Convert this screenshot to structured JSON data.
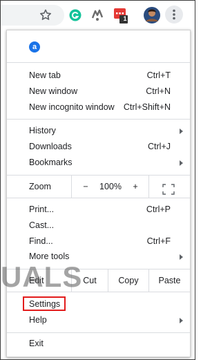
{
  "toolbar": {
    "icons": [
      "star-icon",
      "grammarly-extension-icon",
      "extension-icon",
      "notification-extension-icon",
      "profile-avatar",
      "more-vert-icon"
    ],
    "notification_badge": "1"
  },
  "menu": {
    "top_icon_letter": "a",
    "new_tab": {
      "label": "New tab",
      "shortcut": "Ctrl+T"
    },
    "new_window": {
      "label": "New window",
      "shortcut": "Ctrl+N"
    },
    "new_incognito": {
      "label": "New incognito window",
      "shortcut": "Ctrl+Shift+N"
    },
    "history": {
      "label": "History"
    },
    "downloads": {
      "label": "Downloads",
      "shortcut": "Ctrl+J"
    },
    "bookmarks": {
      "label": "Bookmarks"
    },
    "zoom": {
      "label": "Zoom",
      "minus": "−",
      "value": "100%",
      "plus": "+"
    },
    "print": {
      "label": "Print...",
      "shortcut": "Ctrl+P"
    },
    "cast": {
      "label": "Cast..."
    },
    "find": {
      "label": "Find...",
      "shortcut": "Ctrl+F"
    },
    "more_tools": {
      "label": "More tools"
    },
    "edit": {
      "label": "Edit",
      "cut": "Cut",
      "copy": "Copy",
      "paste": "Paste"
    },
    "settings": {
      "label": "Settings"
    },
    "help": {
      "label": "Help"
    },
    "exit": {
      "label": "Exit"
    }
  },
  "watermark": {
    "text": "UALS"
  },
  "colors": {
    "highlight": "#e21b1b",
    "grammarly": "#15c39a",
    "avatar": "#2b4c7e"
  }
}
